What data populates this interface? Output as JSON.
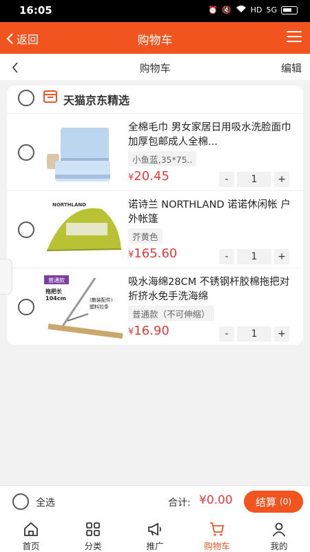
{
  "status_bar": {
    "time": "16:05",
    "indicators": [
      "alarm-icon",
      "mute-icon",
      "wifi-icon",
      "HD",
      "5G",
      "battery-icon"
    ]
  },
  "header": {
    "back_label": "返回",
    "title": "购物车",
    "menu_icon": "hamburger-icon"
  },
  "subheader": {
    "title": "购物车",
    "edit_label": "编辑"
  },
  "store": {
    "name": "天猫京东精选",
    "icon": "shop-icon"
  },
  "items": [
    {
      "title": "全棉毛巾 男女家居日用吸水洗脸面巾加厚包邮成人全棉...",
      "sku": "小鱼蓝,35*75..",
      "currency": "¥",
      "price": "20.45",
      "qty": "1"
    },
    {
      "title": "诺诗兰 NORTHLAND 诺诺休闲帐 户外帐篷",
      "sku": "芥黄色",
      "currency": "¥",
      "price": "165.60",
      "qty": "1",
      "image_text": "NORTHLAND"
    },
    {
      "title": "吸水海绵28CM 不锈钢杆胶棉拖把对折挤水免手洗海绵",
      "sku": "普通款（不可伸缩）",
      "currency": "¥",
      "price": "16.90",
      "qty": "1",
      "image_text": {
        "badge": "普通款",
        "length_label": "拖把长",
        "length": "104cm",
        "note": "(散装配件)",
        "note2": "塑料拉条"
      }
    }
  ],
  "stepper": {
    "minus": "-",
    "plus": "+"
  },
  "settle": {
    "select_all": "全选",
    "total_label": "合计:",
    "total": "¥0.00",
    "checkout_label": "结算",
    "checkout_count": "(0)"
  },
  "tabs": [
    {
      "label": "首页",
      "icon": "home-icon"
    },
    {
      "label": "分类",
      "icon": "grid-icon"
    },
    {
      "label": "推广",
      "icon": "megaphone-icon"
    },
    {
      "label": "购物车",
      "icon": "cart-icon",
      "active": true
    },
    {
      "label": "我的",
      "icon": "user-icon"
    }
  ],
  "colors": {
    "brand": "#f2541f",
    "price": "#e83a3a"
  }
}
